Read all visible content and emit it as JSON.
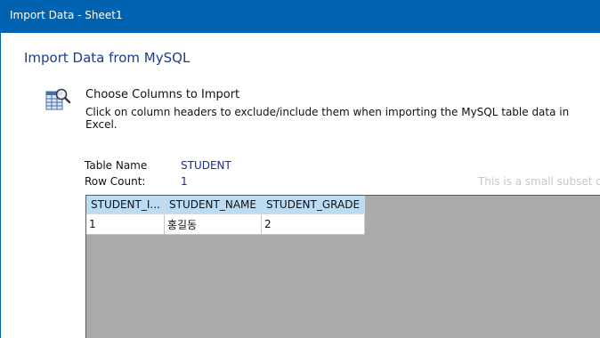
{
  "window": {
    "title": "Import Data - Sheet1"
  },
  "dialog": {
    "title": "Import Data from MySQL"
  },
  "step": {
    "icon": "table-search-icon",
    "heading": "Choose Columns to Import",
    "description": "Click on column headers to exclude/include them when importing the MySQL table data in Excel."
  },
  "info": {
    "table_name_label": "Table Name",
    "table_name_value": "STUDENT",
    "row_count_label": "Row Count:",
    "row_count_value": "1",
    "subset_note": "This is a small subset of t"
  },
  "table": {
    "columns": [
      "STUDENT_I...",
      "STUDENT_NAME",
      "STUDENT_GRADE"
    ],
    "rows": [
      [
        "1",
        "홍길동",
        "2"
      ]
    ]
  },
  "colors": {
    "titlebar": "#0063b1",
    "header_cell": "#bcdcf4",
    "grid_background": "#ababab",
    "title_text": "#1e3c8c"
  }
}
